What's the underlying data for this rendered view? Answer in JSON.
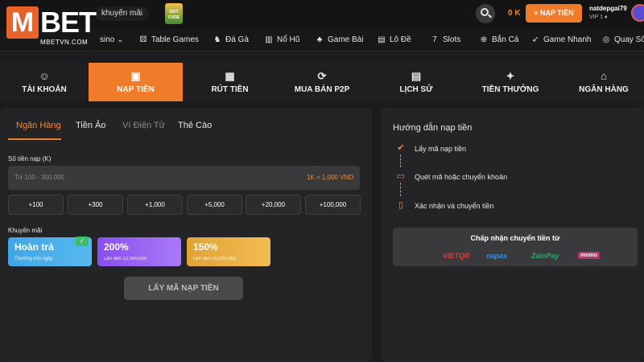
{
  "brand": {
    "name": "BET",
    "initial": "M",
    "sub": "MBETVN.COM",
    "accent": "#f07b2a"
  },
  "header": {
    "promo_label": "khuyến mãi",
    "gift_label": "GIFT CODE",
    "balance": "0 K",
    "deposit_button": "+ NẠP TIỀN",
    "username": "natdepgai79",
    "vip": "VIP 1 ♦"
  },
  "game_nav": [
    {
      "label": "sino ⌄",
      "icon": "chevron-icon"
    },
    {
      "label": "Table Games",
      "icon": "dice-icon"
    },
    {
      "label": "Đá Gà",
      "icon": "rooster-icon"
    },
    {
      "label": "Nổ Hũ",
      "icon": "slot-icon"
    },
    {
      "label": "Game Bài",
      "icon": "club-icon"
    },
    {
      "label": "Lô Đề",
      "icon": "lottery-icon"
    },
    {
      "label": "Slots",
      "icon": "seven-icon"
    },
    {
      "label": "Bắn Cá",
      "icon": "target-icon"
    },
    {
      "label": "Game Nhanh",
      "icon": "rocket-icon"
    },
    {
      "label": "Quay Số",
      "icon": "wheel-icon"
    }
  ],
  "account_tabs": [
    {
      "label": "TÀI KHOẢN",
      "icon": "user-icon"
    },
    {
      "label": "NẠP TIỀN",
      "icon": "wallet-icon"
    },
    {
      "label": "RÚT TIỀN",
      "icon": "cash-icon"
    },
    {
      "label": "MUA BÁN P2P",
      "icon": "exchange-icon"
    },
    {
      "label": "LỊCH SỬ",
      "icon": "history-icon"
    },
    {
      "label": "TIỀN THƯỞNG",
      "icon": "gift-icon"
    },
    {
      "label": "NGÂN HÀNG",
      "icon": "bank-icon"
    }
  ],
  "method_tabs": [
    {
      "label": "Ngân Hàng",
      "state": "active"
    },
    {
      "label": "Tiền Ảo",
      "state": "normal"
    },
    {
      "label": "Ví Điện Tử",
      "state": "dim"
    },
    {
      "label": "Thẻ Cào",
      "state": "normal"
    }
  ],
  "amount": {
    "label": "Số tiền nạp (K)",
    "placeholder": "Từ 100 - 300.000",
    "rate": "1K = 1,000 VND"
  },
  "quick_amounts": [
    "+100",
    "+300",
    "+1,000",
    "+5,000",
    "+20,000",
    "+100,000"
  ],
  "promotions": {
    "label": "Khuyến mãi",
    "items": [
      {
        "title": "Hoàn trả",
        "sub": "Thưởng mỗi ngày",
        "selected": true
      },
      {
        "title": "200%",
        "sub": "Lên đến 12,000,000",
        "selected": false
      },
      {
        "title": "150%",
        "sub": "Lên đến 45,000,000",
        "selected": false
      }
    ]
  },
  "submit_button": "LẤY MÃ NẠP TIỀN",
  "guide": {
    "title": "Hướng dẫn nạp tiền",
    "steps": [
      {
        "text": "Lấy mã nạp tiền",
        "icon": "clipboard-icon"
      },
      {
        "text": "Quét mã hoặc chuyển khoản",
        "icon": "scan-icon"
      },
      {
        "text": "Xác nhận và chuyển tiền",
        "icon": "phone-icon"
      }
    ]
  },
  "accept": {
    "title": "Chấp nhận chuyển tiền từ",
    "logos": [
      {
        "name": "VIETQR",
        "color": "#e23b3b"
      },
      {
        "name": "napas",
        "color": "#3a8fdf"
      },
      {
        "name": "ZaloPay",
        "color": "#2ea66f"
      },
      {
        "name": "momo",
        "color": "#b8336a"
      }
    ]
  }
}
